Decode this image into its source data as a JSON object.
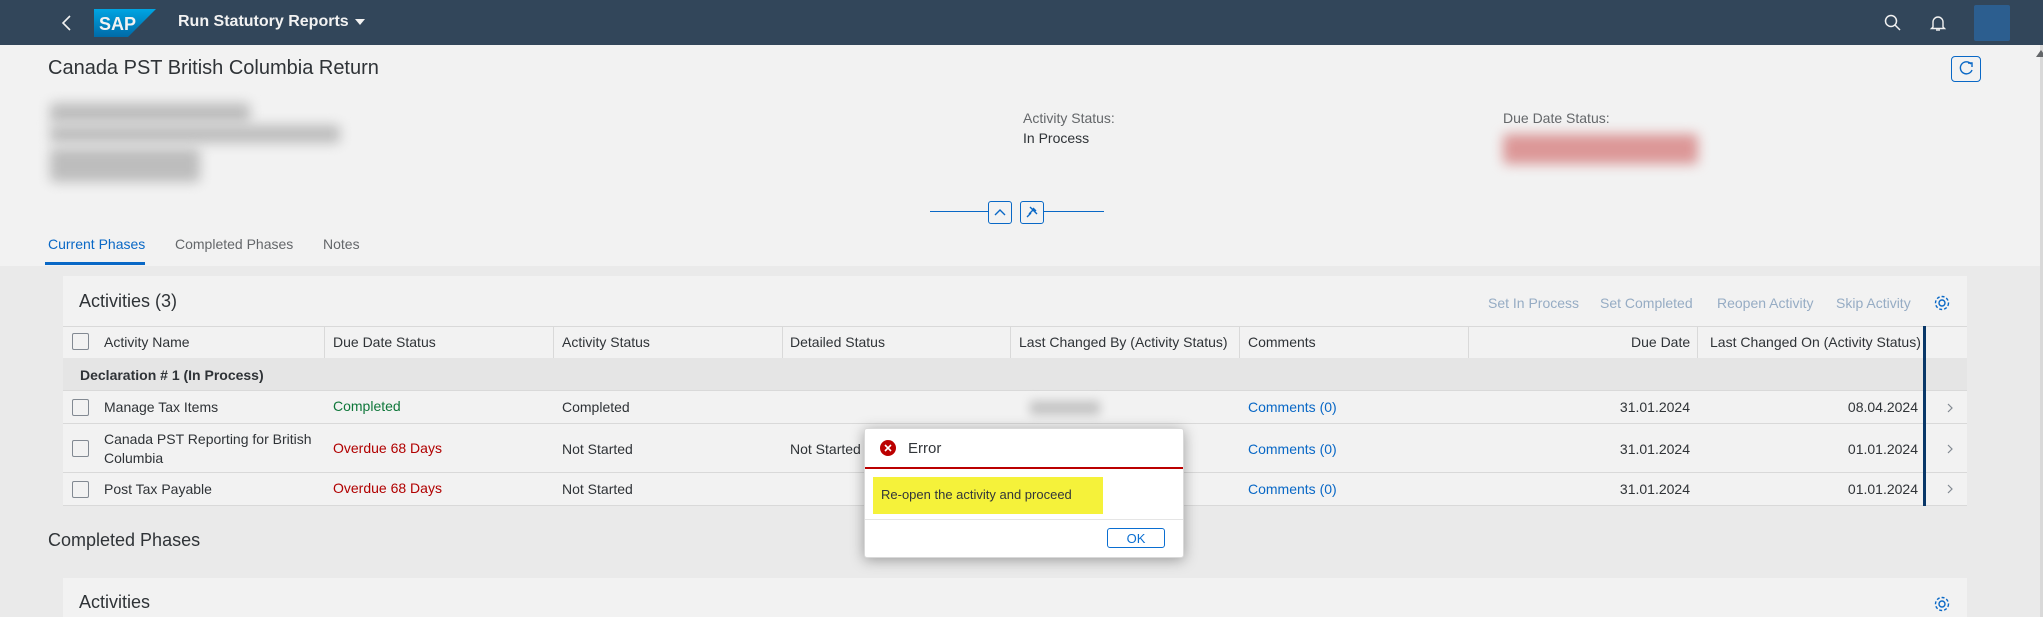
{
  "shell": {
    "app_title": "Run Statutory Reports",
    "logo_text": "SAP"
  },
  "header": {
    "page_title": "Canada PST British Columbia Return",
    "activity_status_label": "Activity Status:",
    "activity_status_value": "In Process",
    "due_date_status_label": "Due Date Status:"
  },
  "tabs": [
    {
      "label": "Current Phases",
      "active": true
    },
    {
      "label": "Completed Phases",
      "active": false
    },
    {
      "label": "Notes",
      "active": false
    }
  ],
  "activities": {
    "title": "Activities (3)",
    "toolbar": {
      "set_in_process": "Set In Process",
      "set_completed": "Set Completed",
      "reopen_activity": "Reopen Activity",
      "skip_activity": "Skip Activity"
    },
    "columns": [
      "Activity Name",
      "Due Date Status",
      "Activity Status",
      "Detailed Status",
      "Last Changed By (Activity Status)",
      "Comments",
      "Due Date",
      "Last Changed On (Activity Status)"
    ],
    "group_label": "Declaration # 1 (In Process)",
    "rows": [
      {
        "name": "Manage Tax Items",
        "due_status": "Completed",
        "status": "Completed",
        "detailed": "",
        "comments": "Comments (0)",
        "due_date": "31.01.2024",
        "changed_on": "08.04.2024"
      },
      {
        "name_line1": "Canada PST Reporting for British",
        "name_line2": "Columbia",
        "due_status": "Overdue 68 Days",
        "status": "Not Started",
        "detailed": "Not Started",
        "comments": "Comments (0)",
        "due_date": "31.01.2024",
        "changed_on": "01.01.2024"
      },
      {
        "name": "Post Tax Payable",
        "due_status": "Overdue 68 Days",
        "status": "Not Started",
        "detailed": "",
        "comments": "Comments (0)",
        "due_date": "31.01.2024",
        "changed_on": "01.01.2024"
      }
    ]
  },
  "completed_section": {
    "title": "Completed Phases",
    "activities_title": "Activities"
  },
  "dialog": {
    "title": "Error",
    "message": "Re-open the activity and proceed",
    "ok_label": "OK"
  },
  "colors": {
    "shell_bg": "#354a5f",
    "accent": "#0a6ed1",
    "error": "#bb0000",
    "success": "#107e3e",
    "highlight": "#f5f23a"
  }
}
